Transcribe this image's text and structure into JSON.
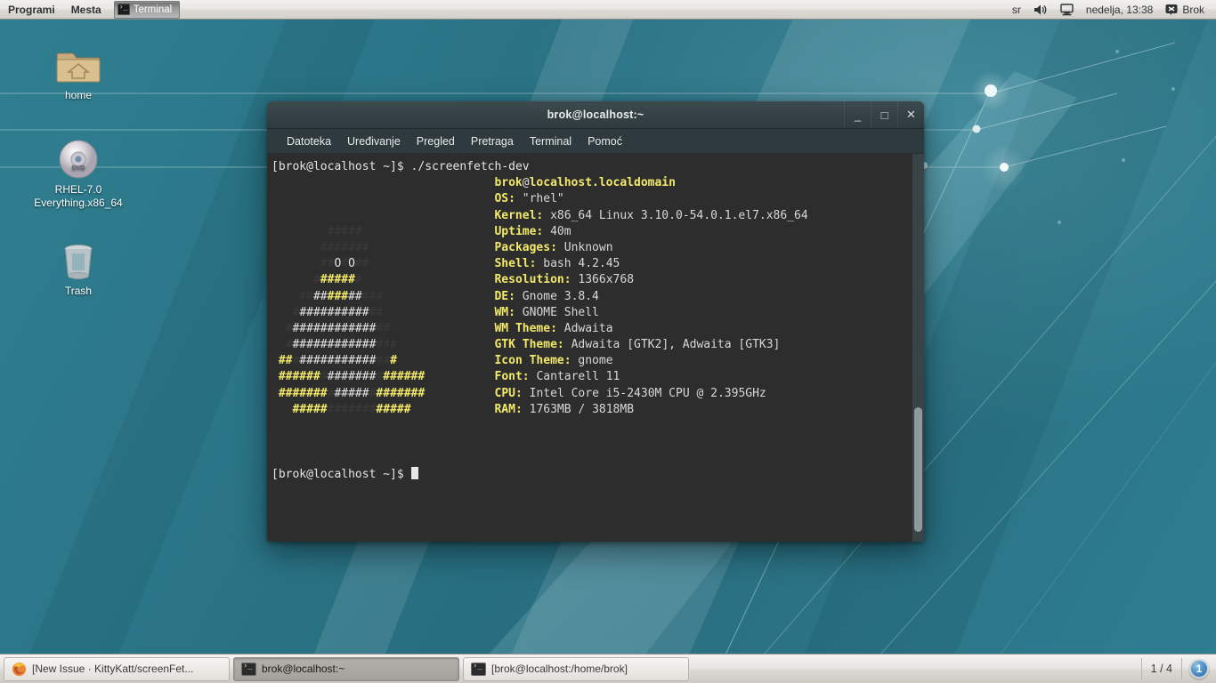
{
  "top_panel": {
    "menus": [
      "Programi",
      "Mesta"
    ],
    "task_button": {
      "label": "Terminal",
      "icon": "terminal-icon"
    },
    "tray": {
      "keyboard_layout": "sr",
      "volume_icon": "volume-icon",
      "display_icon": "display-icon",
      "clock": "nedelja, 13:38",
      "user_icon": "user-icon",
      "user_name": "Brok"
    }
  },
  "desktop_icons": [
    {
      "name": "home",
      "label": "home",
      "icon": "home-folder-icon"
    },
    {
      "name": "rhel-dvd",
      "label": "RHEL-7.0\nEverything.x86_64",
      "label_line1": "RHEL-7.0",
      "label_line2": "Everything.x86_64",
      "icon": "dvd-disc-icon"
    },
    {
      "name": "trash",
      "label": "Trash",
      "icon": "trash-icon"
    }
  ],
  "terminal": {
    "title": "brok@localhost:~",
    "menubar": [
      "Datoteka",
      "Uređivanje",
      "Pregled",
      "Pretraga",
      "Terminal",
      "Pomoć"
    ],
    "window_buttons": {
      "minimize": "_",
      "maximize": "□",
      "close": "✕"
    },
    "prompt": "[brok@localhost ~]$ ",
    "command": "./screenfetch-dev",
    "final_prompt": "[brok@localhost ~]$ ",
    "colors": {
      "background": "#2d2d2d",
      "foreground": "#d8d8d8",
      "accent_yellow": "#f2e96b",
      "ascii_dim": "#3a3a3a",
      "titlebar": "#35414 5"
    },
    "ascii_art": [
      {
        "segs": [
          {
            "t": "       #####",
            "c": "dim"
          }
        ]
      },
      {
        "segs": [
          {
            "t": "      #######",
            "c": "dim"
          }
        ]
      },
      {
        "segs": [
          {
            "t": "      ##",
            "c": "dim"
          },
          {
            "t": "O",
            "c": "white"
          },
          {
            "t": "#",
            "c": "dim"
          },
          {
            "t": "O",
            "c": "white"
          },
          {
            "t": "##",
            "c": "dim"
          }
        ]
      },
      {
        "segs": [
          {
            "t": "     #",
            "c": "dim"
          },
          {
            "t": "#####",
            "c": "yellow"
          },
          {
            "t": "#",
            "c": "dim"
          }
        ]
      },
      {
        "segs": [
          {
            "t": "   #",
            "c": "dim"
          },
          {
            "t": "#",
            "c": "dim"
          },
          {
            "t": "##",
            "c": "white"
          },
          {
            "t": "###",
            "c": "yellow"
          },
          {
            "t": "##",
            "c": "white"
          },
          {
            "t": "#",
            "c": "dim"
          },
          {
            "t": "##",
            "c": "dim"
          }
        ]
      },
      {
        "segs": [
          {
            "t": "  #",
            "c": "dim"
          },
          {
            "t": "##########",
            "c": "white"
          },
          {
            "t": "##",
            "c": "dim"
          }
        ]
      },
      {
        "segs": [
          {
            "t": " #",
            "c": "dim"
          },
          {
            "t": "############",
            "c": "white"
          },
          {
            "t": "##",
            "c": "dim"
          }
        ]
      },
      {
        "segs": [
          {
            "t": " #",
            "c": "dim"
          },
          {
            "t": "############",
            "c": "white"
          },
          {
            "t": "###",
            "c": "dim"
          }
        ]
      },
      {
        "segs": [
          {
            "t": "##",
            "c": "yellow"
          },
          {
            "t": "#",
            "c": "dim"
          },
          {
            "t": "###########",
            "c": "white"
          },
          {
            "t": "##",
            "c": "dim"
          },
          {
            "t": "#",
            "c": "yellow"
          }
        ]
      },
      {
        "segs": [
          {
            "t": "######",
            "c": "yellow"
          },
          {
            "t": "#",
            "c": "dim"
          },
          {
            "t": "#######",
            "c": "white"
          },
          {
            "t": "#",
            "c": "dim"
          },
          {
            "t": "######",
            "c": "yellow"
          }
        ]
      },
      {
        "segs": [
          {
            "t": "#######",
            "c": "yellow"
          },
          {
            "t": "#",
            "c": "dim"
          },
          {
            "t": "#####",
            "c": "white"
          },
          {
            "t": "#",
            "c": "dim"
          },
          {
            "t": "#######",
            "c": "yellow"
          }
        ]
      },
      {
        "segs": [
          {
            "t": "  #####",
            "c": "yellow"
          },
          {
            "t": "#######",
            "c": "dim"
          },
          {
            "t": "#####",
            "c": "yellow"
          }
        ]
      }
    ],
    "info_header": {
      "user": "brok",
      "at": "@",
      "host": "localhost.localdomain"
    },
    "info_rows": [
      {
        "label": "OS:",
        "value": "\"rhel\""
      },
      {
        "label": "Kernel:",
        "value": "x86_64 Linux 3.10.0-54.0.1.el7.x86_64"
      },
      {
        "label": "Uptime:",
        "value": "40m"
      },
      {
        "label": "Packages:",
        "value": "Unknown"
      },
      {
        "label": "Shell:",
        "value": "bash 4.2.45"
      },
      {
        "label": "Resolution:",
        "value": "1366x768"
      },
      {
        "label": "DE:",
        "value": "Gnome 3.8.4"
      },
      {
        "label": "WM:",
        "value": "GNOME Shell"
      },
      {
        "label": "WM Theme:",
        "value": "Adwaita"
      },
      {
        "label": "GTK Theme:",
        "value": "Adwaita [GTK2], Adwaita [GTK3]"
      },
      {
        "label": "Icon Theme:",
        "value": "gnome"
      },
      {
        "label": "Font:",
        "value": "Cantarell 11"
      },
      {
        "label": "CPU:",
        "value": "Intel Core i5-2430M CPU @ 2.395GHz"
      },
      {
        "label": "RAM:",
        "value": "1763MB / 3818MB"
      }
    ]
  },
  "taskbar": {
    "buttons": [
      {
        "label": "[New Issue · KittyKatt/screenFet...",
        "icon": "firefox-icon",
        "active": false
      },
      {
        "label": "brok@localhost:~",
        "icon": "terminal-icon",
        "active": true
      },
      {
        "label": "[brok@localhost:/home/brok]",
        "icon": "terminal-icon",
        "active": false
      }
    ],
    "workspace_indicator": "1 / 4",
    "workspace_badge": "1"
  }
}
